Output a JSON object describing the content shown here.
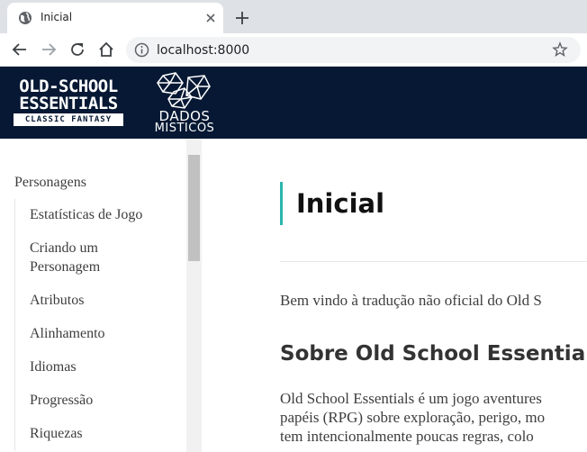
{
  "browser": {
    "tab_title": "Inicial",
    "url": "localhost:8000"
  },
  "header": {
    "logo_ose_line1": "OLD-SCHOOL",
    "logo_ose_line2": "ESSENTIALS",
    "logo_ose_line3": "CLASSIC FANTASY",
    "logo_dados_line1": "DADOS",
    "logo_dados_line2": "MISTICOS"
  },
  "sidebar": {
    "section": "Personagens",
    "items": [
      {
        "label": "Estatísticas de Jogo"
      },
      {
        "label": "Criando um Personagem"
      },
      {
        "label": "Atributos"
      },
      {
        "label": "Alinhamento"
      },
      {
        "label": "Idiomas"
      },
      {
        "label": "Progressão"
      },
      {
        "label": "Riquezas"
      }
    ]
  },
  "main": {
    "title": "Inicial",
    "intro": "Bem vindo à tradução não oficial do Old S",
    "section_title": "Sobre Old School Essentials",
    "para_lines": [
      "Old School Essentials é um jogo aventures",
      "papéis (RPG) sobre exploração, perigo, mo",
      "tem intencionalmente poucas regras, colo"
    ]
  },
  "colors": {
    "header_bg": "#061833",
    "accent": "#2bb6b0"
  }
}
